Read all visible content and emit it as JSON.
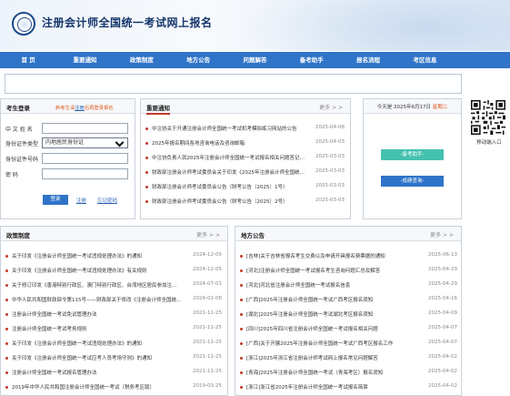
{
  "header": {
    "title": "注册会计师全国统一考试网上报名"
  },
  "nav": [
    "首 页",
    "重要通知",
    "政策制度",
    "地方公告",
    "问题解答",
    "备考助手",
    "报名流程",
    "考区信息"
  ],
  "login": {
    "title": "考生登录",
    "links": {
      "prefix": "新考生请",
      "link": "注册",
      "suffix": "后再登录报名"
    },
    "fields": [
      {
        "label": "中 文 姓 名"
      },
      {
        "label": "身份证件类型",
        "value": "内地居民身份证"
      },
      {
        "label": "身份证件号码"
      },
      {
        "label": "密        码"
      }
    ],
    "login_button": "登录",
    "register_link": "注册",
    "forgot_link": "忘记密码"
  },
  "news": {
    "title": "重要通知",
    "more": "更多 > >",
    "items": [
      {
        "title": "中注协关于开通注册会计师全国统一考试机考模拟练习网站的公告",
        "date": "2025-04-08"
      },
      {
        "title": "2025年报名期间各地咨询电话及咨询邮箱",
        "date": "2025-04-03"
      },
      {
        "title": "中注协负责人就2025年注册会计师全国统一考试报名相关问题答记者问",
        "date": "2025-03-03"
      },
      {
        "title": "财政部注册会计师考试委员会关于印发《2025年注册会计师全国统一考试报名简章》的通知",
        "date": "2025-03-03"
      },
      {
        "title": "财政部注册会计师考试委员会公告（财考公告〔2025〕1号）",
        "date": "2025-03-03"
      },
      {
        "title": "财政部注册会计师考试委员会公告（财考公告〔2025〕2号）",
        "date": "2025-03-03"
      }
    ]
  },
  "datebox": {
    "prefix": "今天是 2025年6月17日",
    "suffix": "星期二",
    "button1": "-备考助手-",
    "button2": "-成绩查询-"
  },
  "qr": {
    "label": "移动端入口"
  },
  "policy": {
    "title": "政策制度",
    "more": "更多 > >",
    "items": [
      {
        "title": "关于印发《注册会计师全国统一考试违规处理办法》的通知",
        "date": "2024-12-05"
      },
      {
        "title": "关于印发《注册会计师全国统一考试违规处理办法》有关规则",
        "date": "2024-12-05"
      },
      {
        "title": "关于修订印发《香港特别行政区、澳门特别行政区、台湾地区居民参加注册会计师全国统一考试办法》的通知",
        "date": "2024-07-01"
      },
      {
        "title": "中华人民共和国财政部令第115号——财政部关于修改《注册会计师全国统一考试办法》的决定",
        "date": "2024-02-08"
      },
      {
        "title": "注册会计师全国统一考试免试管理办法",
        "date": "2021-11-25"
      },
      {
        "title": "注册会计师全国统一考试考务规则",
        "date": "2021-11-25"
      },
      {
        "title": "关于印发《注册会计师全国统一考试违规处理办法》的通知",
        "date": "2021-11-25"
      },
      {
        "title": "关于印发《注册会计师全国统一考试应考人员考场守则》的通知",
        "date": "2021-11-25"
      },
      {
        "title": "注册会计师全国统一考试报名管理办法",
        "date": "2021-11-25"
      },
      {
        "title": "2019年中华人民共和国注册会计师全国统一考试（税务考区版）",
        "date": "2019-03-25"
      }
    ]
  },
  "region": {
    "title": "地方公告",
    "more": "更多 > >",
    "items": [
      {
        "title": "[吉林]关于吉林省报名考生交费以及申请开具报名费票据的通知",
        "date": "2025-06-13"
      },
      {
        "title": "[河北]注册会计师全国统一考试报名考生咨询问题汇总及解答",
        "date": "2025-04-29"
      },
      {
        "title": "[河北]河北省注册会计师全国统一考试报名信息",
        "date": "2025-04-29"
      },
      {
        "title": "[广西]2025年注册会计师全国统一考试广西考区报名须知",
        "date": "2025-04-16"
      },
      {
        "title": "[湖北]2025年注册会计师全国统一考试湖北考区报名须知",
        "date": "2025-04-09"
      },
      {
        "title": "[四川]2025年四川省注册会计师全国统一考试报名相关问题",
        "date": "2025-04-07"
      },
      {
        "title": "[广西]关于开展2025年注册会计师全国统一考试广西考区报名工作",
        "date": "2025-04-07"
      },
      {
        "title": "[浙江]2025年浙江省注册会计师考试网上报名常见问题解答",
        "date": "2025-04-02"
      },
      {
        "title": "[青海]2025年注册会计师全国统一考试（青海考区）报名须知",
        "date": "2025-04-02"
      },
      {
        "title": "[浙江]浙江省2025年注册会计师全国统一考试报名简章",
        "date": "2025-04-02"
      }
    ]
  }
}
